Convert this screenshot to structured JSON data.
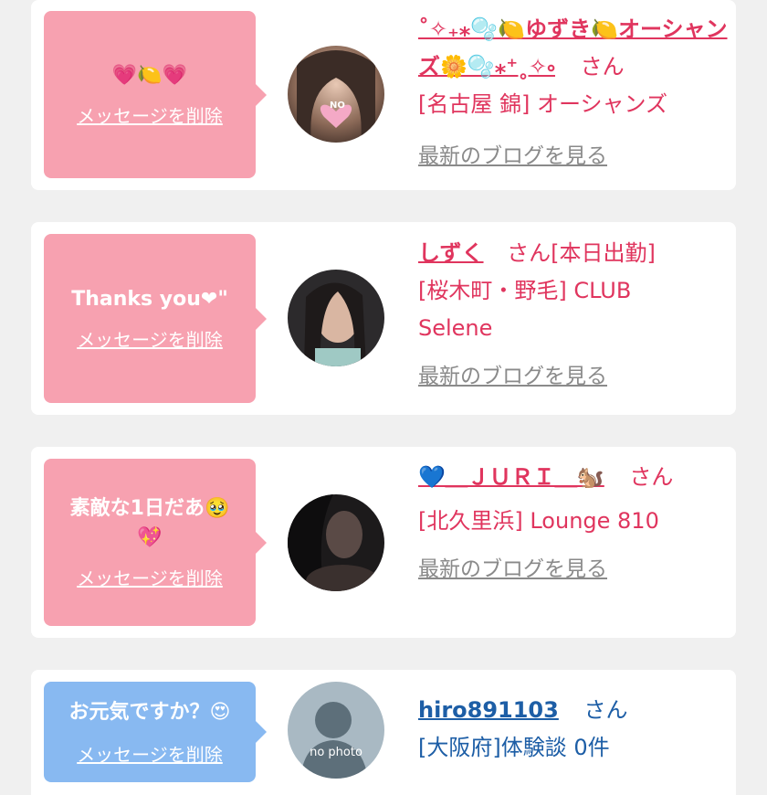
{
  "cards": [
    {
      "message": "💗🍋💗",
      "delete_label": "メッセージを削除",
      "name": "˚✧₊⁎🫧🍋ゆずき🍋オーシャンズ🌼🫧⁎⁺˳✧༚",
      "san": "さん",
      "line2": "[名古屋 錦] オーシャンズ",
      "line3": "",
      "blog_label": "最新のブログを見る",
      "avatar_badge": "NO"
    },
    {
      "message": "Thanks you❤\"",
      "delete_label": "メッセージを削除",
      "name": "しずく",
      "san": "さん[本日出勤]",
      "line2": "[桜木町・野毛] CLUB",
      "line3": "Selene",
      "blog_label": "最新のブログを見る"
    },
    {
      "message": "素敵な1日だあ🥹",
      "message2": "💖",
      "delete_label": "メッセージを削除",
      "name": "💙＿ＪＵＲＩ＿🐿️",
      "san": "さん",
      "line2": "[北久里浜] Lounge 810",
      "line3": "",
      "blog_label": "最新のブログを見る"
    },
    {
      "message": "お元気ですか？😍",
      "delete_label": "メッセージを削除",
      "name": "hiro891103",
      "san": "さん",
      "line2": "[大阪府]体験談 0件",
      "avatar_text": "no photo"
    }
  ],
  "colors": {
    "pink_bubble": "#f7a1b0",
    "blue_bubble": "#88b9f1",
    "pink_text": "#e0355e",
    "blue_text": "#1d5ea6",
    "gray_link": "#8a8a8a"
  }
}
